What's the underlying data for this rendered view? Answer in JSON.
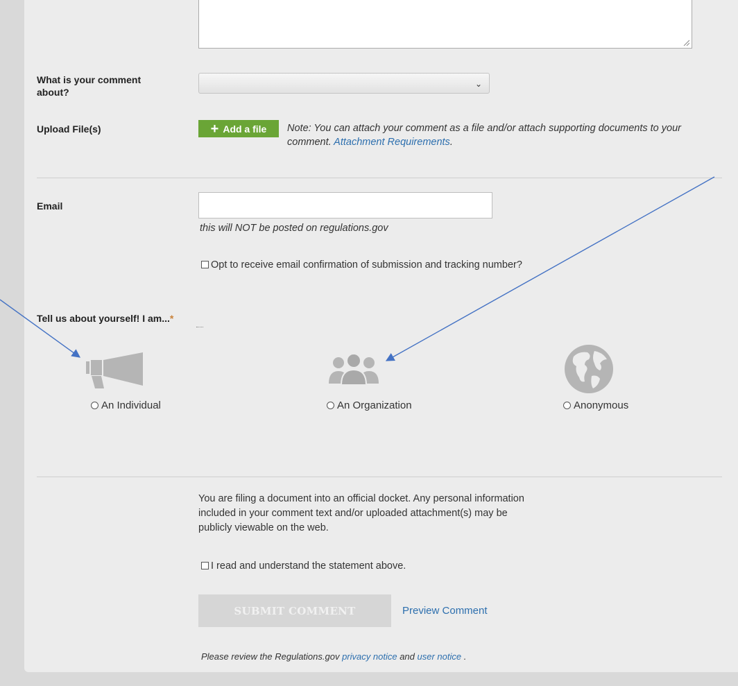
{
  "form": {
    "topic_label": "What is your comment about?",
    "topic_value": "",
    "upload_label": "Upload File(s)",
    "add_file_label": "Add a file",
    "upload_note": "Note: You can attach your comment as a file and/or attach supporting documents to your comment.",
    "attachment_link": "Attachment Requirements",
    "attachment_suffix": ".",
    "email_label": "Email",
    "email_value": "",
    "email_hint": "this will NOT be posted on regulations.gov",
    "opt_email_label": "Opt to receive email confirmation of submission and tracking number?",
    "about_label": "Tell us about yourself! I am...",
    "required_mark": "*",
    "options": [
      {
        "label": "An Individual",
        "icon": "megaphone-icon"
      },
      {
        "label": "An Organization",
        "icon": "group-icon"
      },
      {
        "label": "Anonymous",
        "icon": "globe-icon"
      }
    ],
    "disclaimer": "You are filing a document into an official docket. Any personal information included in your comment text and/or uploaded attachment(s) may be publicly viewable on the web.",
    "acknowledge_label": "I read and understand the statement above.",
    "submit_label": "SUBMIT COMMENT",
    "preview_label": "Preview Comment",
    "footer_prefix": "Please review the Regulations.gov",
    "privacy_link": "privacy notice",
    "footer_and": "and",
    "user_link": "user notice",
    "footer_suffix": "."
  },
  "colors": {
    "add_button": "#6aa536",
    "link": "#2d6fae",
    "annotation_arrow": "#4472c4",
    "submit_disabled": "#d6d6d6"
  }
}
